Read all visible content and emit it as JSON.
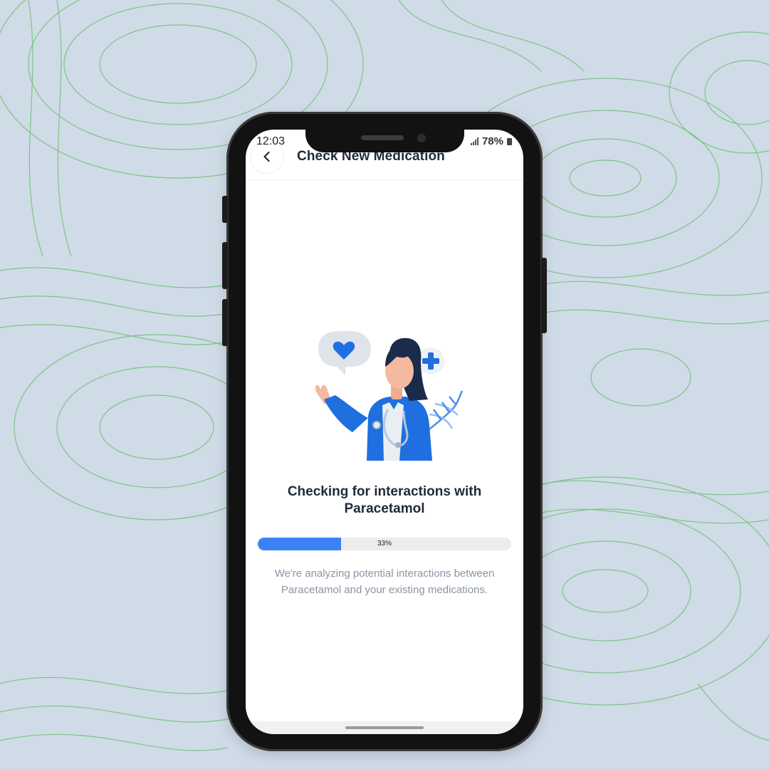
{
  "status_bar": {
    "time": "12:03",
    "battery": "78%",
    "icons": [
      "signal-icon",
      "battery-icon"
    ]
  },
  "header": {
    "title": "Check New Medication",
    "back_icon": "chevron-left-icon"
  },
  "illustration": {
    "icons": [
      "heart-speech-bubble-icon",
      "plus-icon",
      "dna-icon",
      "doctor-illustration"
    ]
  },
  "main": {
    "headline": "Checking for interactions with Paracetamol",
    "progress": {
      "percent": 33,
      "label": "33%"
    },
    "description": "We're analyzing potential interactions between Paracetamol and your existing medications."
  },
  "colors": {
    "accent": "#3b82f6",
    "doctor_coat": "#1f6fe0",
    "background": "#cfdbe7",
    "contour_lines": "#6fbf73",
    "title_text": "#1f2a3a",
    "muted_text": "#8a94a3"
  }
}
